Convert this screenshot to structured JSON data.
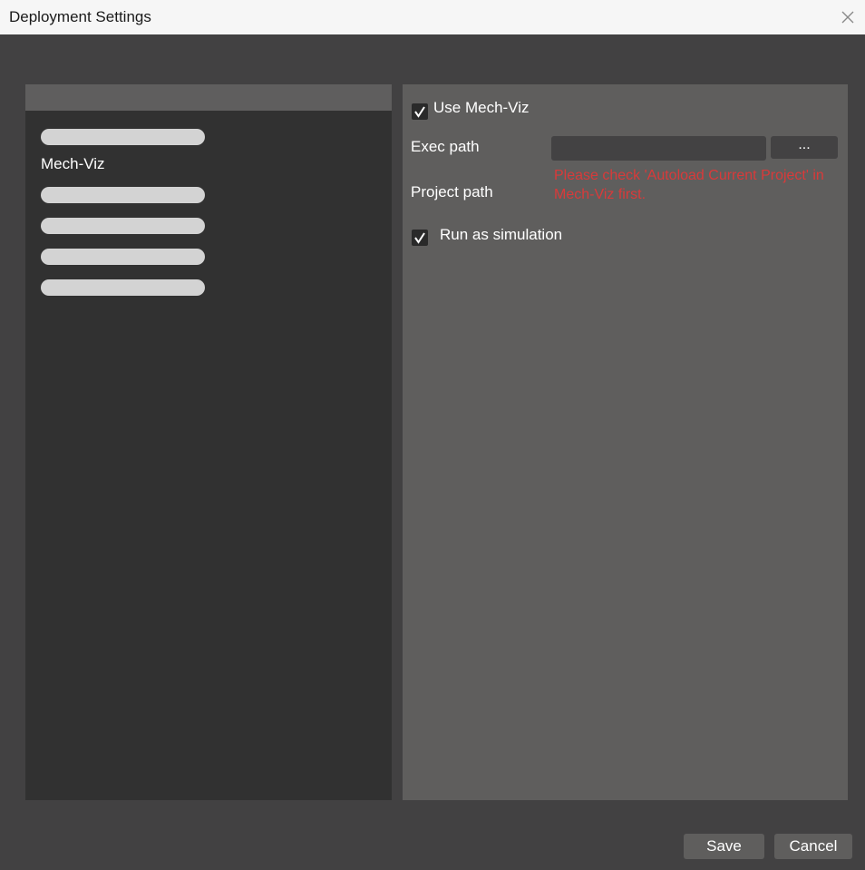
{
  "window": {
    "title": "Deployment Settings",
    "close_icon": "close-icon"
  },
  "sidebar": {
    "items": [
      {
        "label": "",
        "redacted": true
      },
      {
        "label": "Mech-Viz",
        "redacted": false
      },
      {
        "label": "",
        "redacted": true
      },
      {
        "label": "",
        "redacted": true
      },
      {
        "label": "",
        "redacted": true
      },
      {
        "label": "",
        "redacted": true
      }
    ]
  },
  "settings": {
    "use_mechviz_label": "Use Mech-Viz",
    "use_mechviz_checked": true,
    "exec_path_label": "Exec path",
    "exec_path_value": "",
    "browse_label": "...",
    "project_path_label": "Project path",
    "warning_text": "Please check 'Autoload Current Project' in Mech-Viz first.",
    "run_simulation_label": "Run as simulation",
    "run_simulation_checked": true
  },
  "footer": {
    "save_label": "Save",
    "cancel_label": "Cancel"
  },
  "colors": {
    "background": "#424142",
    "left_panel": "#313131",
    "right_panel": "#5f5e5d",
    "warning": "#d93a3a",
    "titlebar": "#f6f6f6"
  }
}
